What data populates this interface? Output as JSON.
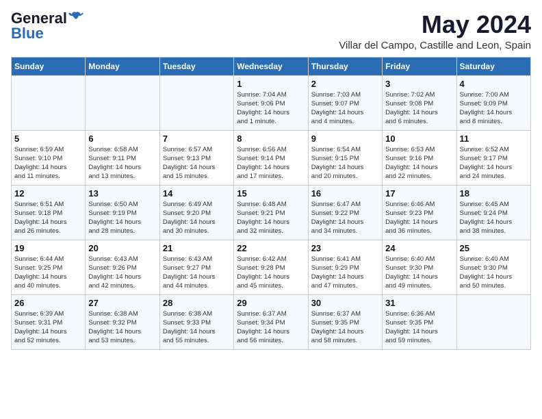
{
  "header": {
    "logo_general": "General",
    "logo_blue": "Blue",
    "month": "May 2024",
    "location": "Villar del Campo, Castille and Leon, Spain"
  },
  "days_of_week": [
    "Sunday",
    "Monday",
    "Tuesday",
    "Wednesday",
    "Thursday",
    "Friday",
    "Saturday"
  ],
  "weeks": [
    [
      {
        "day": "",
        "info": ""
      },
      {
        "day": "",
        "info": ""
      },
      {
        "day": "",
        "info": ""
      },
      {
        "day": "1",
        "info": "Sunrise: 7:04 AM\nSunset: 9:06 PM\nDaylight: 14 hours\nand 1 minute."
      },
      {
        "day": "2",
        "info": "Sunrise: 7:03 AM\nSunset: 9:07 PM\nDaylight: 14 hours\nand 4 minutes."
      },
      {
        "day": "3",
        "info": "Sunrise: 7:02 AM\nSunset: 9:08 PM\nDaylight: 14 hours\nand 6 minutes."
      },
      {
        "day": "4",
        "info": "Sunrise: 7:00 AM\nSunset: 9:09 PM\nDaylight: 14 hours\nand 8 minutes."
      }
    ],
    [
      {
        "day": "5",
        "info": "Sunrise: 6:59 AM\nSunset: 9:10 PM\nDaylight: 14 hours\nand 11 minutes."
      },
      {
        "day": "6",
        "info": "Sunrise: 6:58 AM\nSunset: 9:11 PM\nDaylight: 14 hours\nand 13 minutes."
      },
      {
        "day": "7",
        "info": "Sunrise: 6:57 AM\nSunset: 9:13 PM\nDaylight: 14 hours\nand 15 minutes."
      },
      {
        "day": "8",
        "info": "Sunrise: 6:56 AM\nSunset: 9:14 PM\nDaylight: 14 hours\nand 17 minutes."
      },
      {
        "day": "9",
        "info": "Sunrise: 6:54 AM\nSunset: 9:15 PM\nDaylight: 14 hours\nand 20 minutes."
      },
      {
        "day": "10",
        "info": "Sunrise: 6:53 AM\nSunset: 9:16 PM\nDaylight: 14 hours\nand 22 minutes."
      },
      {
        "day": "11",
        "info": "Sunrise: 6:52 AM\nSunset: 9:17 PM\nDaylight: 14 hours\nand 24 minutes."
      }
    ],
    [
      {
        "day": "12",
        "info": "Sunrise: 6:51 AM\nSunset: 9:18 PM\nDaylight: 14 hours\nand 26 minutes."
      },
      {
        "day": "13",
        "info": "Sunrise: 6:50 AM\nSunset: 9:19 PM\nDaylight: 14 hours\nand 28 minutes."
      },
      {
        "day": "14",
        "info": "Sunrise: 6:49 AM\nSunset: 9:20 PM\nDaylight: 14 hours\nand 30 minutes."
      },
      {
        "day": "15",
        "info": "Sunrise: 6:48 AM\nSunset: 9:21 PM\nDaylight: 14 hours\nand 32 minutes."
      },
      {
        "day": "16",
        "info": "Sunrise: 6:47 AM\nSunset: 9:22 PM\nDaylight: 14 hours\nand 34 minutes."
      },
      {
        "day": "17",
        "info": "Sunrise: 6:46 AM\nSunset: 9:23 PM\nDaylight: 14 hours\nand 36 minutes."
      },
      {
        "day": "18",
        "info": "Sunrise: 6:45 AM\nSunset: 9:24 PM\nDaylight: 14 hours\nand 38 minutes."
      }
    ],
    [
      {
        "day": "19",
        "info": "Sunrise: 6:44 AM\nSunset: 9:25 PM\nDaylight: 14 hours\nand 40 minutes."
      },
      {
        "day": "20",
        "info": "Sunrise: 6:43 AM\nSunset: 9:26 PM\nDaylight: 14 hours\nand 42 minutes."
      },
      {
        "day": "21",
        "info": "Sunrise: 6:43 AM\nSunset: 9:27 PM\nDaylight: 14 hours\nand 44 minutes."
      },
      {
        "day": "22",
        "info": "Sunrise: 6:42 AM\nSunset: 9:28 PM\nDaylight: 14 hours\nand 45 minutes."
      },
      {
        "day": "23",
        "info": "Sunrise: 6:41 AM\nSunset: 9:29 PM\nDaylight: 14 hours\nand 47 minutes."
      },
      {
        "day": "24",
        "info": "Sunrise: 6:40 AM\nSunset: 9:30 PM\nDaylight: 14 hours\nand 49 minutes."
      },
      {
        "day": "25",
        "info": "Sunrise: 6:40 AM\nSunset: 9:30 PM\nDaylight: 14 hours\nand 50 minutes."
      }
    ],
    [
      {
        "day": "26",
        "info": "Sunrise: 6:39 AM\nSunset: 9:31 PM\nDaylight: 14 hours\nand 52 minutes."
      },
      {
        "day": "27",
        "info": "Sunrise: 6:38 AM\nSunset: 9:32 PM\nDaylight: 14 hours\nand 53 minutes."
      },
      {
        "day": "28",
        "info": "Sunrise: 6:38 AM\nSunset: 9:33 PM\nDaylight: 14 hours\nand 55 minutes."
      },
      {
        "day": "29",
        "info": "Sunrise: 6:37 AM\nSunset: 9:34 PM\nDaylight: 14 hours\nand 56 minutes."
      },
      {
        "day": "30",
        "info": "Sunrise: 6:37 AM\nSunset: 9:35 PM\nDaylight: 14 hours\nand 58 minutes."
      },
      {
        "day": "31",
        "info": "Sunrise: 6:36 AM\nSunset: 9:35 PM\nDaylight: 14 hours\nand 59 minutes."
      },
      {
        "day": "",
        "info": ""
      }
    ]
  ]
}
